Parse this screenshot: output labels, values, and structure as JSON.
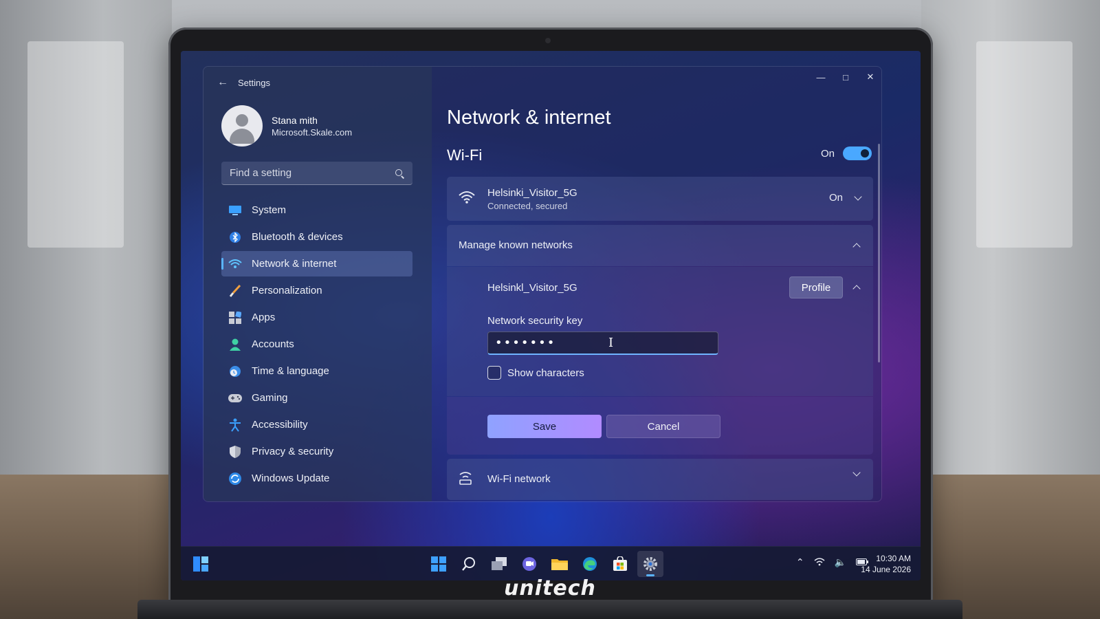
{
  "settings": {
    "app_title": "Settings",
    "user": {
      "name": "Stana mith",
      "email": "Microsoft.Skale.com"
    },
    "search": {
      "placeholder": "Find a setting"
    },
    "nav": [
      {
        "label": "System",
        "icon": "system-icon"
      },
      {
        "label": "Bluetooth & devices",
        "icon": "bluetooth-icon"
      },
      {
        "label": "Network & internet",
        "icon": "wifi-icon",
        "active": true
      },
      {
        "label": "Personalization",
        "icon": "brush-icon"
      },
      {
        "label": "Apps",
        "icon": "apps-icon"
      },
      {
        "label": "Accounts",
        "icon": "person-icon"
      },
      {
        "label": "Time & language",
        "icon": "clock-globe-icon"
      },
      {
        "label": "Gaming",
        "icon": "gamepad-icon"
      },
      {
        "label": "Accessibility",
        "icon": "accessibility-icon"
      },
      {
        "label": "Privacy & security",
        "icon": "shield-icon"
      },
      {
        "label": "Windows Update",
        "icon": "update-icon"
      }
    ]
  },
  "main": {
    "page_title": "Network & internet",
    "wifi": {
      "heading": "Wi-Fi",
      "toggle_label": "On",
      "toggle_on": true
    },
    "connection": {
      "ssid": "Helsinki_Visitor_5G",
      "status": "Connected, secured",
      "state": "On"
    },
    "manage": {
      "label": "Manage known networks"
    },
    "known_network": {
      "ssid": "Helsinkl_Visitor_5G",
      "profile_button": "Profile",
      "key_label": "Network security key",
      "key_value": "•••••••",
      "show_characters_label": "Show characters",
      "show_characters_checked": false
    },
    "actions": {
      "save": "Save",
      "cancel": "Cancel"
    },
    "wifi_network": {
      "label": "Wi-Fi network"
    }
  },
  "taskbar": {
    "time": "10:30 AM",
    "date": "14 June 2026"
  },
  "brand": "unitech",
  "colors": {
    "accent": "#4aa8ff",
    "save_button": "#9b99ff"
  }
}
